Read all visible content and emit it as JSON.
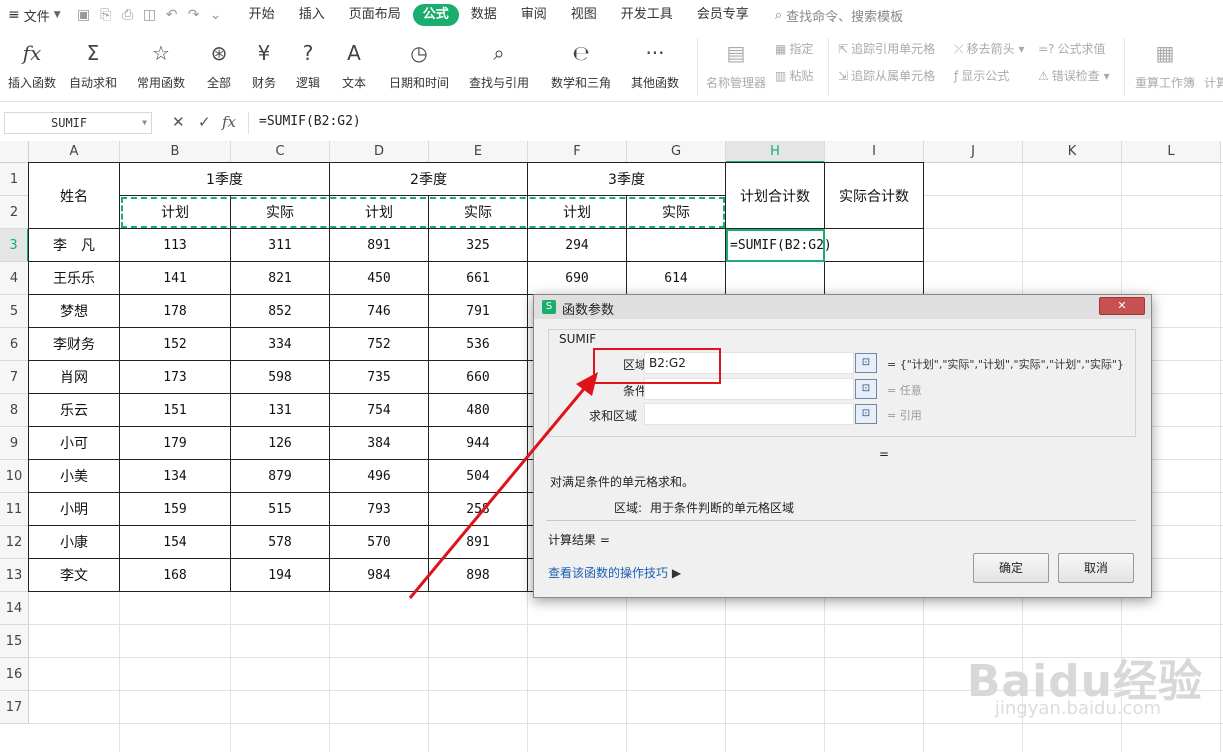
{
  "menubar": {
    "file_label": "文件",
    "tabs": [
      "开始",
      "插入",
      "页面布局",
      "公式",
      "数据",
      "审阅",
      "视图",
      "开发工具",
      "会员专享"
    ],
    "active_tab": "公式",
    "search_placeholder": "查找命令、搜索模板"
  },
  "ribbon": {
    "main": [
      "插入函数",
      "自动求和",
      "常用函数",
      "全部",
      "财务",
      "逻辑",
      "文本",
      "日期和时间",
      "查找与引用",
      "数学和三角",
      "其他函数"
    ],
    "name_manager": "名称管理器",
    "specify": "指定",
    "paste": "粘贴",
    "trace_precedents": "追踪引用单元格",
    "trace_dependents": "追踪从属单元格",
    "remove_arrows": "移去箭头",
    "show_formulas": "显示公式",
    "evaluate": "公式求值",
    "error_check": "错误检查",
    "recalc": "重算工作簿",
    "calc": "计算"
  },
  "formula_bar": {
    "name_box": "SUMIF",
    "formula": "=SUMIF(B2:G2)"
  },
  "sheet": {
    "columns": [
      "A",
      "B",
      "C",
      "D",
      "E",
      "F",
      "G",
      "H",
      "I",
      "J",
      "K",
      "L"
    ],
    "selected_column": "H",
    "rows": [
      "1",
      "2",
      "3",
      "4",
      "5",
      "6",
      "7",
      "8",
      "9",
      "10",
      "11",
      "12",
      "13",
      "14",
      "15",
      "16",
      "17"
    ],
    "selected_row": "3",
    "header": {
      "name": "姓名",
      "q1": "1季度",
      "q2": "2季度",
      "q3": "3季度",
      "plan": "计划",
      "actual": "实际",
      "plan_total": "计划合计数",
      "actual_total": "实际合计数"
    },
    "active_cell_text": "=SUMIF(B2:G2)",
    "data": [
      {
        "name": "李　凡",
        "b": "113",
        "c": "311",
        "d": "891",
        "e": "325",
        "f": "294",
        "g": ""
      },
      {
        "name": "王乐乐",
        "b": "141",
        "c": "821",
        "d": "450",
        "e": "661",
        "f": "690",
        "g": "614"
      },
      {
        "name": "梦想",
        "b": "178",
        "c": "852",
        "d": "746",
        "e": "791",
        "f": "",
        "g": ""
      },
      {
        "name": "李财务",
        "b": "152",
        "c": "334",
        "d": "752",
        "e": "536",
        "f": "",
        "g": ""
      },
      {
        "name": "肖网",
        "b": "173",
        "c": "598",
        "d": "735",
        "e": "660",
        "f": "",
        "g": ""
      },
      {
        "name": "乐云",
        "b": "151",
        "c": "131",
        "d": "754",
        "e": "480",
        "f": "",
        "g": ""
      },
      {
        "name": "小可",
        "b": "179",
        "c": "126",
        "d": "384",
        "e": "944",
        "f": "",
        "g": ""
      },
      {
        "name": "小美",
        "b": "134",
        "c": "879",
        "d": "496",
        "e": "504",
        "f": "",
        "g": ""
      },
      {
        "name": "小明",
        "b": "159",
        "c": "515",
        "d": "793",
        "e": "258",
        "f": "",
        "g": ""
      },
      {
        "name": "小康",
        "b": "154",
        "c": "578",
        "d": "570",
        "e": "891",
        "f": "",
        "g": ""
      },
      {
        "name": "李文",
        "b": "168",
        "c": "194",
        "d": "984",
        "e": "898",
        "f": "",
        "g": ""
      }
    ]
  },
  "dialog": {
    "title": "函数参数",
    "function_name": "SUMIF",
    "args": [
      {
        "label": "区域",
        "value": "B2:G2",
        "result": "= {\"计划\",\"实际\",\"计划\",\"实际\",\"计划\",\"实际\"}"
      },
      {
        "label": "条件",
        "value": "",
        "result": "= 任意"
      },
      {
        "label": "求和区域",
        "value": "",
        "result": "= 引用"
      }
    ],
    "equals": "=",
    "description": "对满足条件的单元格求和。",
    "arg_help_label": "区域:",
    "arg_help_text": "用于条件判断的单元格区域",
    "calc_result": "计算结果 =",
    "help_link": "查看该函数的操作技巧",
    "ok": "确定",
    "cancel": "取消"
  },
  "watermark": {
    "brand": "Baidu经验",
    "url": "jingyan.baidu.com"
  },
  "colors": {
    "accent": "#1aad6d",
    "highlight_red": "#e0121a"
  }
}
